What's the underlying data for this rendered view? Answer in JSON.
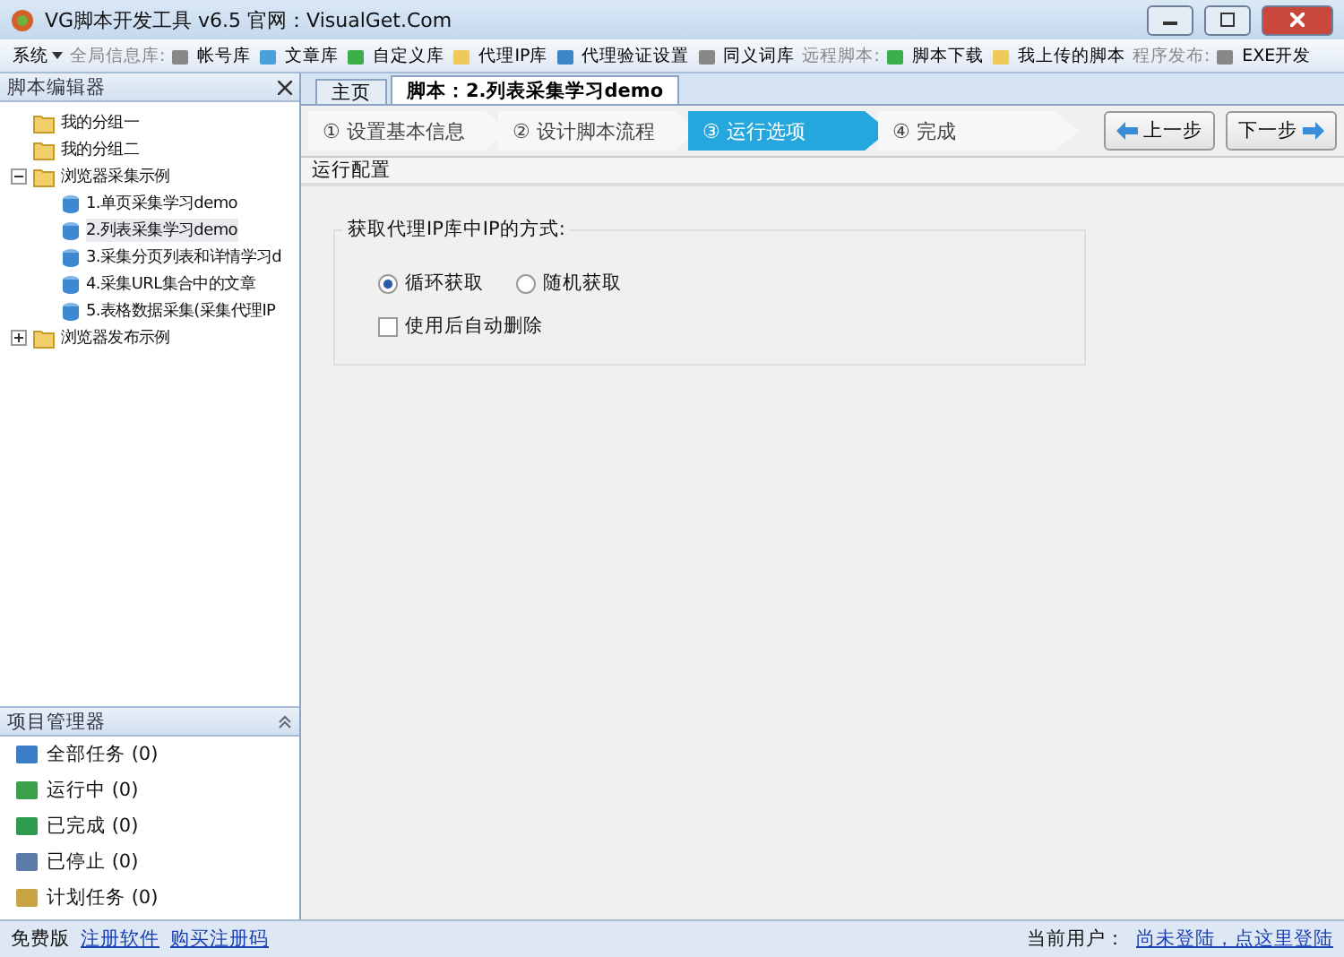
{
  "window": {
    "title": "VG脚本开发工具 v6.5 官网：VisualGet.Com"
  },
  "toolbar": [
    {
      "kind": "menu",
      "label": "系统"
    },
    {
      "kind": "label",
      "label": "全局信息库:"
    },
    {
      "kind": "button",
      "label": "帐号库"
    },
    {
      "kind": "button",
      "label": "文章库"
    },
    {
      "kind": "button",
      "label": "自定义库"
    },
    {
      "kind": "button",
      "label": "代理IP库"
    },
    {
      "kind": "button",
      "label": "代理验证设置"
    },
    {
      "kind": "button",
      "label": "同义词库"
    },
    {
      "kind": "label",
      "label": "远程脚本:"
    },
    {
      "kind": "button",
      "label": "脚本下载"
    },
    {
      "kind": "button",
      "label": "我上传的脚本"
    },
    {
      "kind": "label",
      "label": "程序发布:"
    },
    {
      "kind": "button",
      "label": "EXE开发"
    }
  ],
  "script_editor": {
    "title": "脚本编辑器",
    "tree": [
      {
        "label": "我的分组一",
        "kind": "folder",
        "selected": false
      },
      {
        "label": "我的分组二",
        "kind": "folder",
        "selected": false
      },
      {
        "label": "浏览器采集示例",
        "kind": "folder",
        "expanded": true,
        "selected": false,
        "children": [
          {
            "label": "1.单页采集学习demo",
            "kind": "script",
            "selected": false
          },
          {
            "label": "2.列表采集学习demo",
            "kind": "script",
            "selected": true
          },
          {
            "label": "3.采集分页列表和详情学习d",
            "kind": "script",
            "selected": false
          },
          {
            "label": "4.采集URL集合中的文章",
            "kind": "script",
            "selected": false
          },
          {
            "label": "5.表格数据采集(采集代理IP",
            "kind": "script",
            "selected": false
          }
        ]
      },
      {
        "label": "浏览器发布示例",
        "kind": "folder",
        "expanded": false,
        "selected": false
      }
    ]
  },
  "project_manager": {
    "title": "项目管理器",
    "items": [
      {
        "label": "全部任务 (0)",
        "kind": "all"
      },
      {
        "label": "运行中 (0)",
        "kind": "running"
      },
      {
        "label": "已完成 (0)",
        "kind": "done"
      },
      {
        "label": "已停止 (0)",
        "kind": "stopped"
      },
      {
        "label": "计划任务 (0)",
        "kind": "scheduled"
      }
    ]
  },
  "tabs": [
    {
      "label": "主页",
      "selected": false
    },
    {
      "label": "脚本：2.列表采集学习demo",
      "selected": true
    }
  ],
  "steps": [
    {
      "label": "① 设置基本信息",
      "selected": false
    },
    {
      "label": "② 设计脚本流程",
      "selected": false
    },
    {
      "label": "③ 运行选项",
      "selected": true
    },
    {
      "label": "④ 完成",
      "selected": false
    }
  ],
  "nav_buttons": [
    {
      "label": "上一步",
      "kind": "prev"
    },
    {
      "label": "下一步",
      "kind": "next"
    }
  ],
  "section_title": "运行配置",
  "group": {
    "title": "获取代理IP库中IP的方式:",
    "options": [
      {
        "label": "循环获取",
        "selected": true
      },
      {
        "label": "随机获取",
        "selected": false
      }
    ],
    "checkbox": {
      "label": "使用后自动删除",
      "checked": false
    }
  },
  "status_bar": {
    "edition": "免费版",
    "links": [
      "注册软件",
      "购买注册码"
    ],
    "user_label": "当前用户：",
    "user_link": "尚未登陆，点这里登陆"
  }
}
